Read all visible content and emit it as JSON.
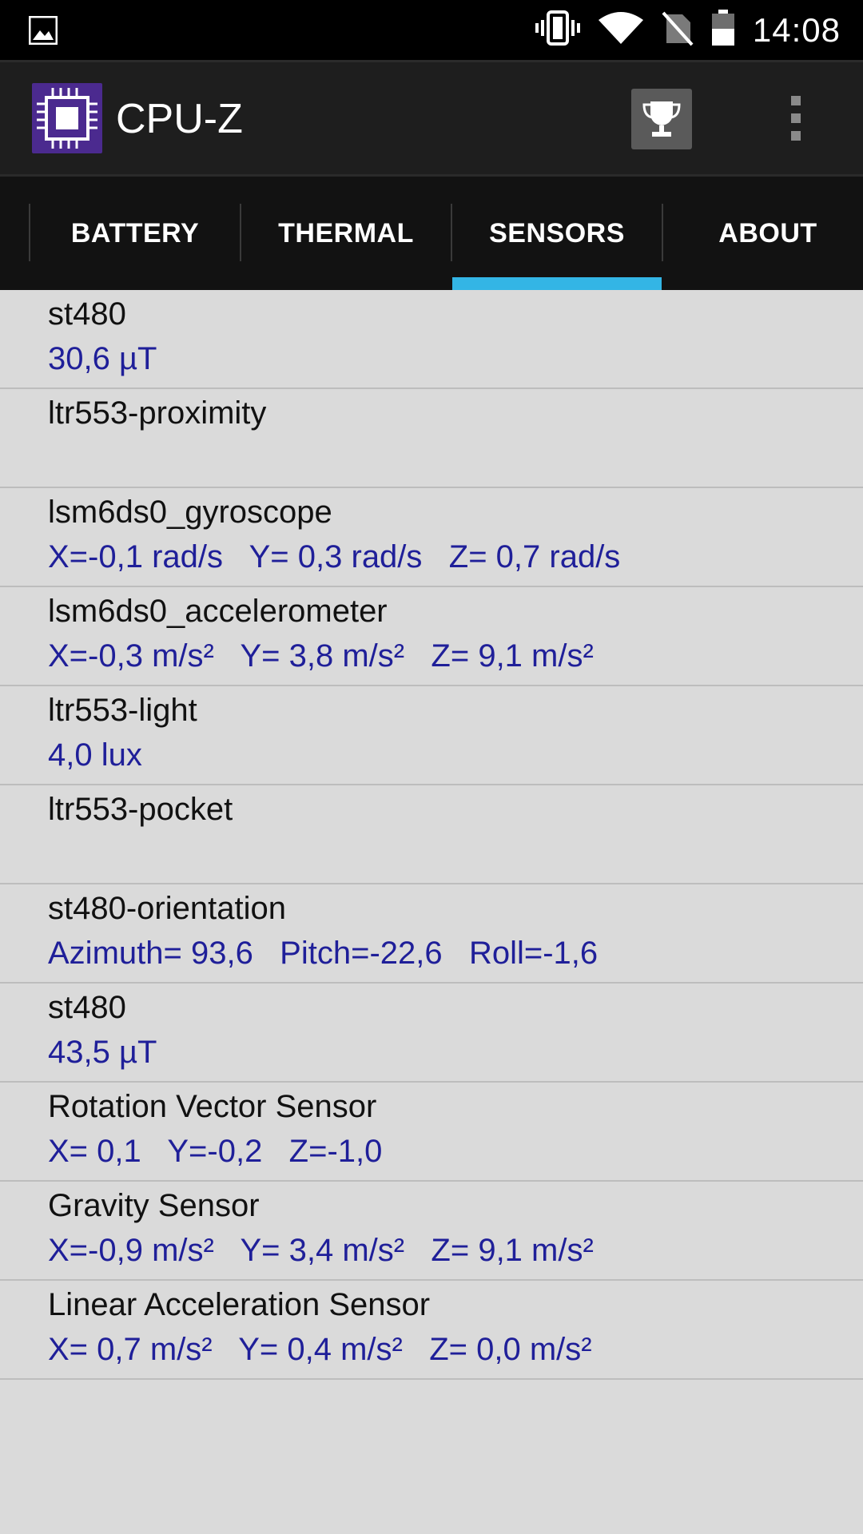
{
  "status_bar": {
    "time": "14:08",
    "icons": [
      "gallery-icon",
      "vibrate-icon",
      "wifi-icon",
      "no-sim-icon",
      "battery-icon"
    ]
  },
  "app_bar": {
    "title": "CPU-Z",
    "icons": [
      "cpu-z-logo",
      "trophy-icon",
      "overflow-menu-icon"
    ]
  },
  "tabs": [
    {
      "label": "BATTERY",
      "selected": false
    },
    {
      "label": "THERMAL",
      "selected": false
    },
    {
      "label": "SENSORS",
      "selected": true
    },
    {
      "label": "ABOUT",
      "selected": false
    }
  ],
  "colors": {
    "accent": "#33b5e5",
    "value_text": "#1f1f99",
    "list_bg": "#dadada"
  },
  "sensors": [
    {
      "name": "st480",
      "value": "30,6 µT"
    },
    {
      "name": "ltr553-proximity",
      "value": ""
    },
    {
      "name": "lsm6ds0_gyroscope",
      "value": "X=-0,1 rad/s   Y= 0,3 rad/s   Z= 0,7 rad/s"
    },
    {
      "name": "lsm6ds0_accelerometer",
      "value": "X=-0,3 m/s²   Y= 3,8 m/s²   Z= 9,1 m/s²"
    },
    {
      "name": "ltr553-light",
      "value": "4,0 lux"
    },
    {
      "name": "ltr553-pocket",
      "value": ""
    },
    {
      "name": "st480-orientation",
      "value": "Azimuth= 93,6   Pitch=-22,6   Roll=-1,6"
    },
    {
      "name": "st480",
      "value": "43,5 µT"
    },
    {
      "name": "Rotation Vector Sensor",
      "value": "X= 0,1   Y=-0,2   Z=-1,0"
    },
    {
      "name": "Gravity Sensor",
      "value": "X=-0,9 m/s²   Y= 3,4 m/s²   Z= 9,1 m/s²"
    },
    {
      "name": "Linear Acceleration Sensor",
      "value": "X= 0,7 m/s²   Y= 0,4 m/s²   Z= 0,0 m/s²"
    }
  ]
}
